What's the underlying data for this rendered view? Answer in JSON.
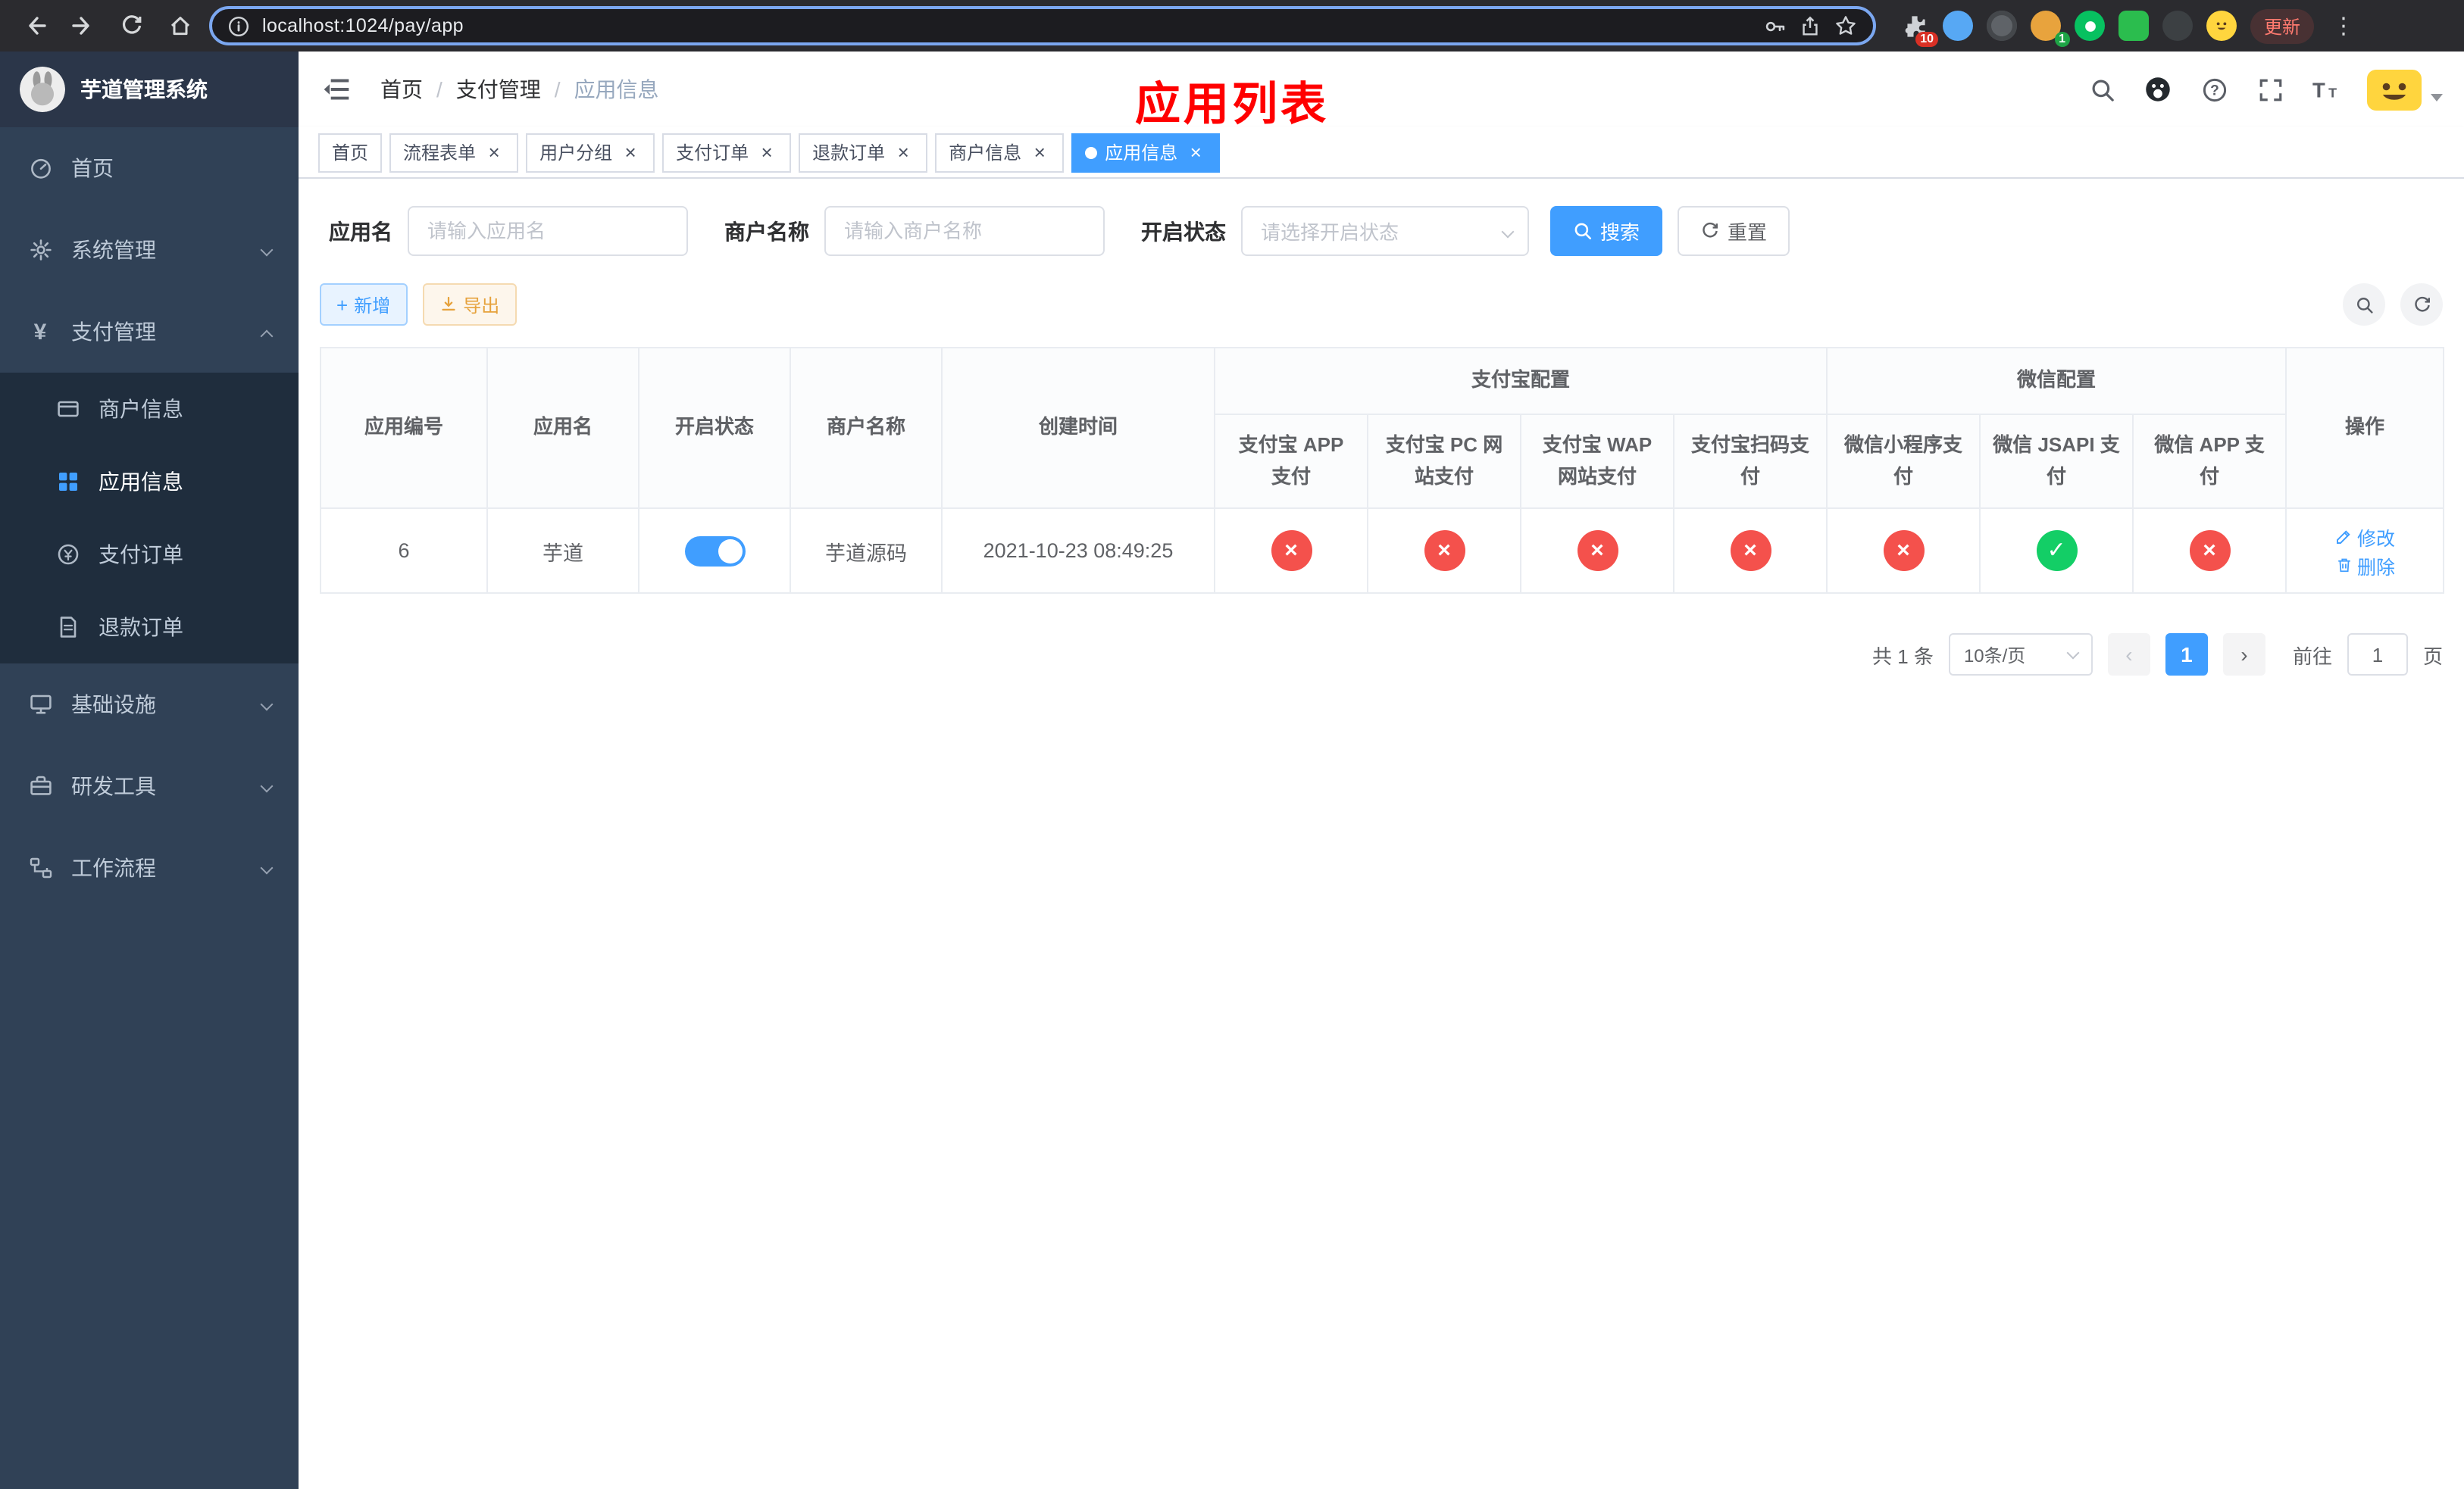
{
  "colors": {
    "accent": "#409eff",
    "ok": "#13ce66",
    "bad": "#f4514c",
    "warning": "#e6a23c",
    "annotation": "#ff0000"
  },
  "browser": {
    "url": "localhost:1024/pay/app",
    "update_label": "更新",
    "extensions_badge": "10",
    "profile_badge": "1",
    "extension_icons": [
      "puzzle",
      "blue-extension",
      "dark-extension",
      "avatar-extension",
      "green-chat-extension",
      "green-app-extension",
      "dark-pin-extension",
      "emoji-face-extension"
    ]
  },
  "sidebar": {
    "title": "芋道管理系统",
    "items": [
      {
        "label": "首页"
      },
      {
        "label": "系统管理"
      },
      {
        "label": "支付管理"
      },
      {
        "label": "基础设施"
      },
      {
        "label": "研发工具"
      },
      {
        "label": "工作流程"
      }
    ],
    "payment_submenu": [
      {
        "label": "商户信息"
      },
      {
        "label": "应用信息"
      },
      {
        "label": "支付订单"
      },
      {
        "label": "退款订单"
      }
    ]
  },
  "navbar": {
    "breadcrumb": [
      "首页",
      "支付管理",
      "应用信息"
    ]
  },
  "annotation": "应用列表",
  "tabs": [
    {
      "label": "首页"
    },
    {
      "label": "流程表单"
    },
    {
      "label": "用户分组"
    },
    {
      "label": "支付订单"
    },
    {
      "label": "退款订单"
    },
    {
      "label": "商户信息"
    },
    {
      "label": "应用信息"
    }
  ],
  "filters": {
    "app_name_label": "应用名",
    "app_name_placeholder": "请输入应用名",
    "merchant_label": "商户名称",
    "merchant_placeholder": "请输入商户名称",
    "status_label": "开启状态",
    "status_placeholder": "请选择开启状态",
    "search_label": "搜索",
    "reset_label": "重置"
  },
  "toolbar": {
    "add_label": "新增",
    "export_label": "导出"
  },
  "table": {
    "group_alipay": "支付宝配置",
    "group_wechat": "微信配置",
    "columns": {
      "id": "应用编号",
      "name": "应用名",
      "status": "开启状态",
      "merchant": "商户名称",
      "created": "创建时间",
      "op": "操作",
      "alipay_app": "支付宝 APP 支付",
      "alipay_pc": "支付宝 PC 网站支付",
      "alipay_wap": "支付宝 WAP 网站支付",
      "alipay_qr": "支付宝扫码支付",
      "wx_lite": "微信小程序支付",
      "wx_jsapi": "微信 JSAPI 支付",
      "wx_app": "微信 APP 支付"
    },
    "row": {
      "id": "6",
      "name": "芋道",
      "status_on": true,
      "merchant": "芋道源码",
      "created": "2021-10-23 08:49:25",
      "configs": [
        false,
        false,
        false,
        false,
        false,
        true,
        false
      ],
      "edit_label": "修改",
      "delete_label": "删除"
    }
  },
  "pagination": {
    "total_text": "共 1 条",
    "page_size": "10条/页",
    "current_page": "1",
    "goto_label": "前往",
    "goto_value": "1",
    "page_unit": "页"
  }
}
